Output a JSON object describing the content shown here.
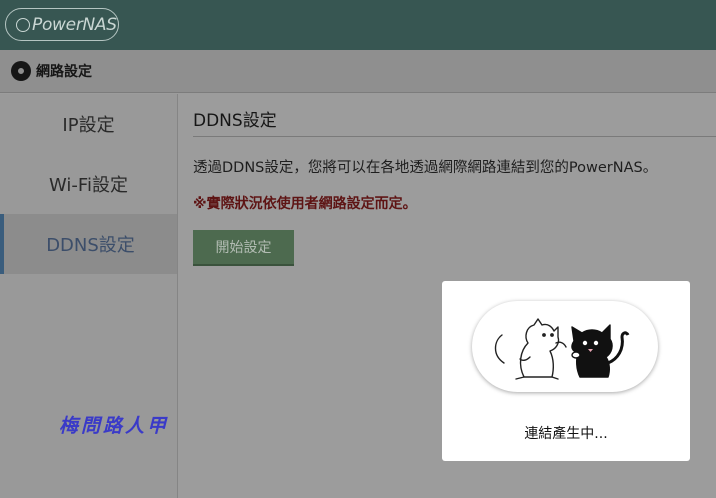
{
  "app": {
    "logo_text": "PowerNAS"
  },
  "titlebar": {
    "title": "網路設定",
    "icon": "gear-icon"
  },
  "sidebar": {
    "items": [
      {
        "label": "IP設定",
        "active": false
      },
      {
        "label": "Wi-Fi設定",
        "active": false
      },
      {
        "label": "DDNS設定",
        "active": true
      }
    ]
  },
  "main": {
    "section_title": "DDNS設定",
    "description": "透過DDNS設定，您將可以在各地透過網際網路連結到您的PowerNAS。",
    "warning": "※實際狀況依使用者網路設定而定。",
    "start_button": "開始設定"
  },
  "watermark": "梅問路人甲",
  "modal": {
    "loading_text": "連結產生中...",
    "icon": "cats-loading-icon"
  },
  "colors": {
    "topbar": "#375652",
    "warning": "#5e1414",
    "start_button": "#4d6a4f",
    "active_sidebar_accent": "#3a5d7d"
  }
}
